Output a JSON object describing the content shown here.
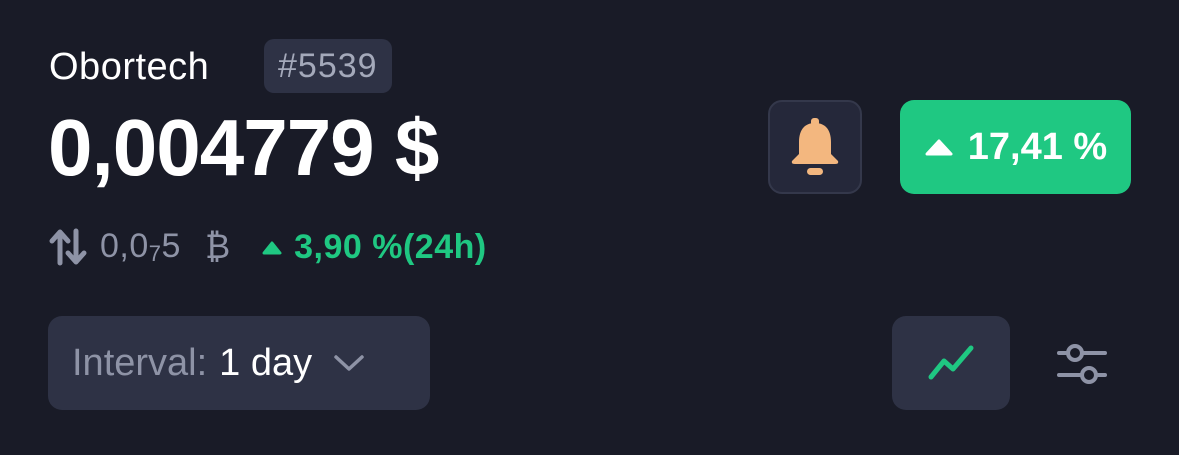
{
  "header": {
    "coin_name": "Obortech",
    "rank": "#5539",
    "price": "0,004779 $"
  },
  "btc": {
    "value_prefix": "0,0",
    "value_subscript": "7",
    "value_suffix": "5",
    "symbol": "₿",
    "change": "3,90 %(24h)",
    "change_direction": "up"
  },
  "actions": {
    "alert_icon": "bell-icon",
    "change_percent": "17,41 %",
    "change_direction": "up"
  },
  "controls": {
    "interval_label": "Interval:",
    "interval_value": "1 day",
    "chart_icon": "line-chart-icon",
    "settings_icon": "sliders-icon"
  },
  "colors": {
    "background": "#191b27",
    "surface": "#2e3245",
    "positive": "#1fc882",
    "bell": "#f3b77f",
    "muted_text": "#8e93a6"
  }
}
